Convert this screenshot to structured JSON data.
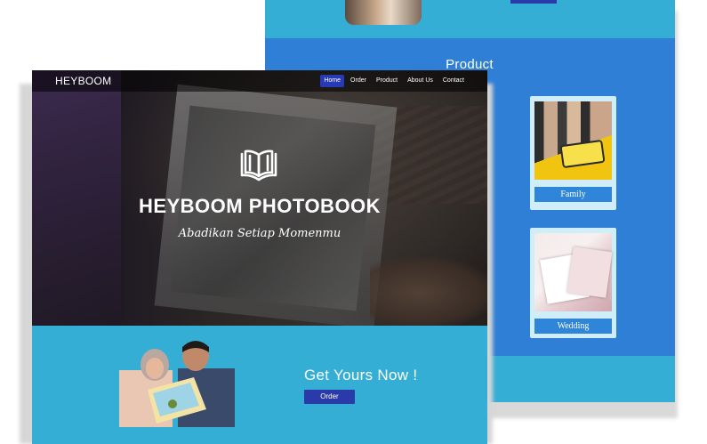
{
  "product_page": {
    "title": "Product",
    "cards": [
      {
        "label": "Family"
      },
      {
        "label": "Wedding"
      }
    ]
  },
  "home_page": {
    "navbar": {
      "brand": "HEYBOOM",
      "items": [
        {
          "label": "Home",
          "active": true
        },
        {
          "label": "Order"
        },
        {
          "label": "Product"
        },
        {
          "label": "About Us"
        },
        {
          "label": "Contact"
        }
      ]
    },
    "hero": {
      "icon": "open-book-icon",
      "title": "HEYBOOM PHOTOBOOK",
      "subtitle": "Abadikan Setiap Momenmu"
    },
    "cta": {
      "title": "Get Yours Now !",
      "button": "Order"
    }
  },
  "colors": {
    "cyan_section": "#35aed6",
    "product_bg": "#2f7fd6",
    "button_navy": "#2a3aa8",
    "nav_active": "#2739b4"
  }
}
